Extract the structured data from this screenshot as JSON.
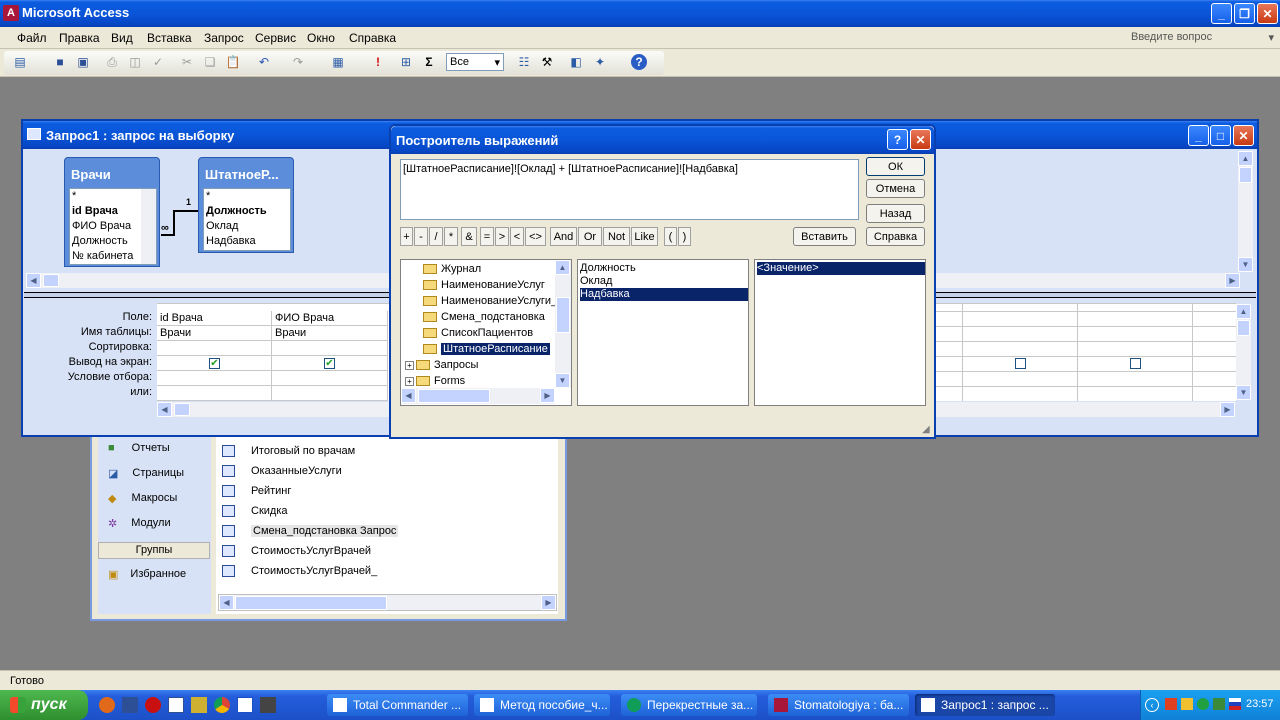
{
  "app": {
    "title": "Microsoft Access",
    "help_placeholder": "Введите вопрос"
  },
  "menu": [
    "Файл",
    "Правка",
    "Вид",
    "Вставка",
    "Запрос",
    "Сервис",
    "Окно",
    "Справка"
  ],
  "toolbar": {
    "combo_value": "Все"
  },
  "query_window": {
    "title": "Запрос1 : запрос на выборку"
  },
  "table_vrachi": {
    "title": "Врачи",
    "fields": [
      "*",
      "id Врача",
      "ФИО Врача",
      "Должность",
      "№ кабинета"
    ]
  },
  "table_shtat": {
    "title": "ШтатноеР...",
    "fields": [
      "*",
      "Должность",
      "Оклад",
      "Надбавка"
    ]
  },
  "relation": {
    "one": "1",
    "many": "∞"
  },
  "grid": {
    "row_labels": [
      "Поле:",
      "Имя таблицы:",
      "Сортировка:",
      "Вывод на экран:",
      "Условие отбора:",
      "или:"
    ],
    "columns": [
      {
        "field": "id Врача",
        "table": "Врачи"
      },
      {
        "field": "ФИО Врача",
        "table": "Врачи"
      }
    ]
  },
  "builder": {
    "title": "Построитель выражений",
    "expression": "[ШтатноеРасписание]![Оклад] + [ШтатноеРасписание]![Надбавка]",
    "buttons": {
      "ok": "ОК",
      "cancel": "Отмена",
      "back": "Назад",
      "paste": "Вставить",
      "help": "Справка"
    },
    "operators": [
      "+",
      "-",
      "/",
      "*",
      "&",
      "=",
      ">",
      "<",
      "<>",
      "And",
      "Or",
      "Not",
      "Like",
      "(",
      ")"
    ],
    "tree": [
      "Журнал",
      "НаименованиеУслуг",
      "НаименованиеУслуги_",
      "Смена_подстановка",
      "СписокПациентов",
      "ШтатноеРасписание",
      "Запросы",
      "Forms"
    ],
    "fields": [
      "Должность",
      "Оклад",
      "Надбавка"
    ],
    "values": [
      "<Значение>"
    ]
  },
  "db_window": {
    "groups": [
      "Отчеты",
      "Страницы",
      "Макросы",
      "Модули"
    ],
    "groups_header": "Группы",
    "favorites": "Избранное",
    "objects": [
      "Итоговый по врачам",
      "ОказанныеУслуги",
      "Рейтинг",
      "Скидка",
      "Смена_подстановка Запрос",
      "СтоимостьУслугВрачей",
      "СтоимостьУслугВрачей_"
    ]
  },
  "status": {
    "text": "Готово"
  },
  "taskbar": {
    "start": "пуск",
    "tasks": [
      "Total Commander ...",
      "Метод пособие_ч...",
      "Перекрестные за...",
      "Stomatologiya : ба...",
      "Запрос1 : запрос ..."
    ],
    "clock": "23:57"
  }
}
